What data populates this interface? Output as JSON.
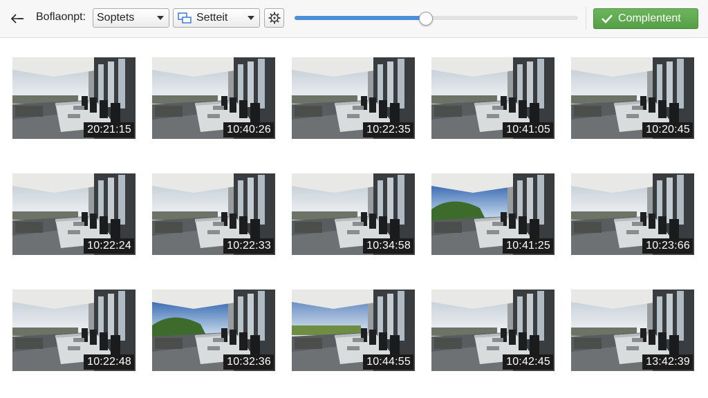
{
  "toolbar": {
    "title": "Boflaonpt:",
    "sort_dropdown": "Soptets",
    "set_dropdown": "Setteit",
    "zoom_fraction": 0.46,
    "complete_label": "Complentent",
    "accent_color": "#4a90d9",
    "complete_color": "#5faa50"
  },
  "thumbnails": [
    {
      "time": "20:21:15",
      "sky": "overcast"
    },
    {
      "time": "10:40:26",
      "sky": "overcast"
    },
    {
      "time": "10:22:35",
      "sky": "overcast"
    },
    {
      "time": "10:41:05",
      "sky": "overcast"
    },
    {
      "time": "10:20:45",
      "sky": "overcast"
    },
    {
      "time": "10:22:24",
      "sky": "overcast"
    },
    {
      "time": "10:22:33",
      "sky": "overcast"
    },
    {
      "time": "10:34:58",
      "sky": "overcast"
    },
    {
      "time": "10:41:25",
      "sky": "blue-hills"
    },
    {
      "time": "10:23:66",
      "sky": "overcast"
    },
    {
      "time": "10:22:48",
      "sky": "overcast"
    },
    {
      "time": "10:32:36",
      "sky": "blue-hills"
    },
    {
      "time": "10:44:55",
      "sky": "blue-field"
    },
    {
      "time": "10:42:45",
      "sky": "overcast"
    },
    {
      "time": "13:42:39",
      "sky": "overcast"
    }
  ]
}
